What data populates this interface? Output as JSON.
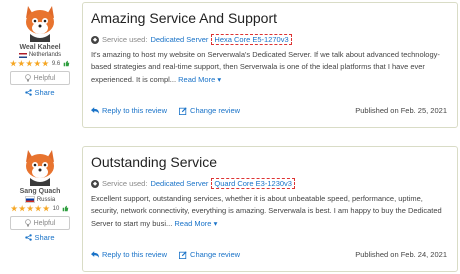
{
  "reviews": [
    {
      "user": "Weal Kaheel",
      "country": "Netherlands",
      "score": "9.6",
      "helpful": "Helpful",
      "share": "Share",
      "title": "Amazing Service And Support",
      "service_used_label": "Service used:",
      "service": "Dedicated Server",
      "cpu": "Hexa Core E5-1270v3",
      "text": "It's amazing to host my website on Serverwala's Dedicated Server. If we talk about advanced technology-based strategies and real-time support, then Serverwala is one of the ideal platforms that I have ever experienced. It is compl...",
      "read_more": "Read More",
      "reply": "Reply to this review",
      "change": "Change review",
      "published": "Published on Feb. 25, 2021"
    },
    {
      "user": "Sang Quach",
      "country": "Russia",
      "score": "10",
      "helpful": "Helpful",
      "share": "Share",
      "title": "Outstanding Service",
      "service_used_label": "Service used:",
      "service": "Dedicated Server",
      "cpu": "Quard Core E3-1230v3",
      "text": "Excellent support, outstanding services, whether it is about unbeatable speed, performance, uptime, security, network connectivity, everything is amazing. Serverwala is best. I am happy to buy the Dedicated Server to start my busi...",
      "read_more": "Read More",
      "reply": "Reply to this review",
      "change": "Change review",
      "published": "Published on Feb. 24, 2021"
    }
  ],
  "colors": {
    "link": "#1a73c8",
    "star": "#f5a623",
    "card_border": "#d9dcc6",
    "cpu_border": "#d33"
  }
}
